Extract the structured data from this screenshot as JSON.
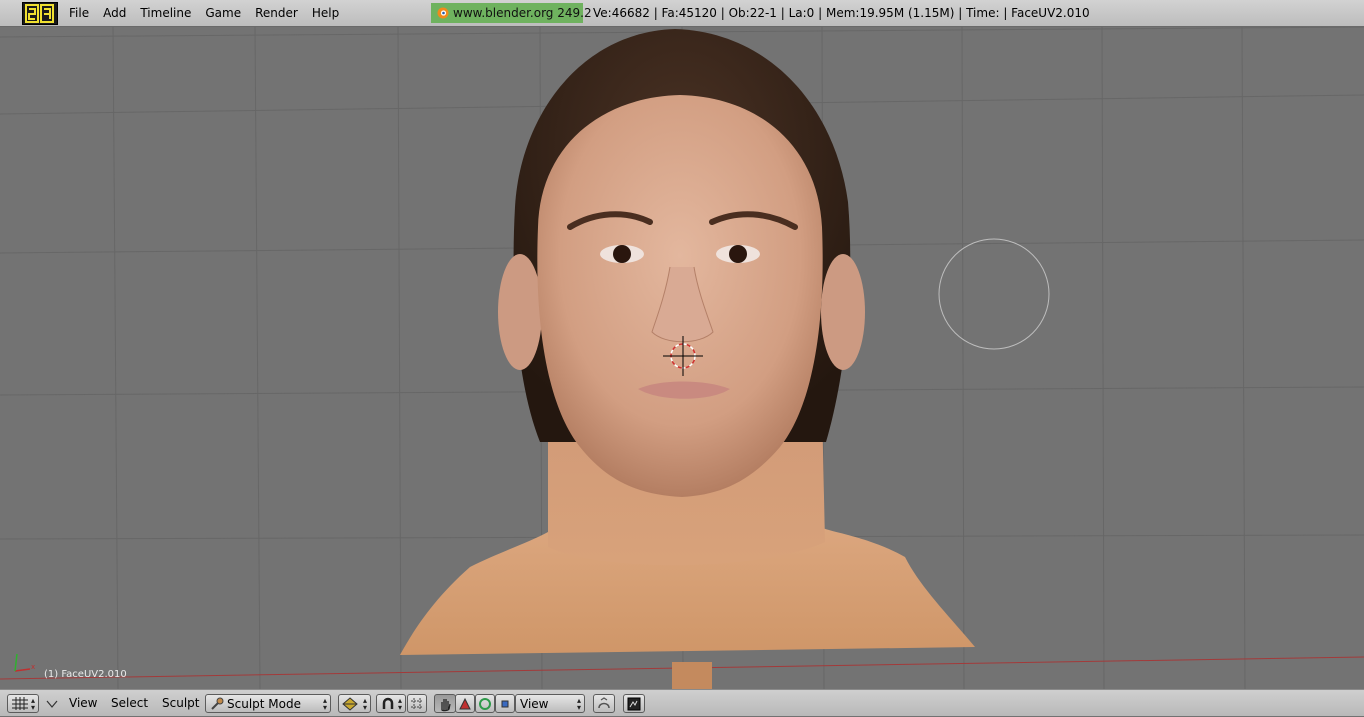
{
  "app": {
    "menu": [
      "File",
      "Add",
      "Timeline",
      "Game",
      "Render",
      "Help"
    ],
    "site_badge": "www.blender.org 249.2",
    "stats": "Ve:46682 | Fa:45120 | Ob:22-1 | La:0  | Mem:19.95M (1.15M)  | Time: | FaceUV2.010"
  },
  "viewport": {
    "object_label": "(1) FaceUV2.010"
  },
  "header": {
    "menu": [
      "View",
      "Select",
      "Sculpt"
    ],
    "mode": "Sculpt Mode",
    "view_select": "View"
  },
  "icons": {
    "logo": "blender-window-type-icon",
    "editor_type": "grid-icon",
    "site": "blender-logo-icon",
    "draw_type": "shaded-sphere-icon",
    "pivot": "magnet-icon",
    "hand": "hand-icon",
    "layers": "manipulator-icons",
    "render": "render-icon"
  },
  "colors": {
    "viewport_bg": "#737373",
    "grid": "#676767",
    "site_badge": "#6fb25f",
    "x_axis": "#b03030"
  }
}
